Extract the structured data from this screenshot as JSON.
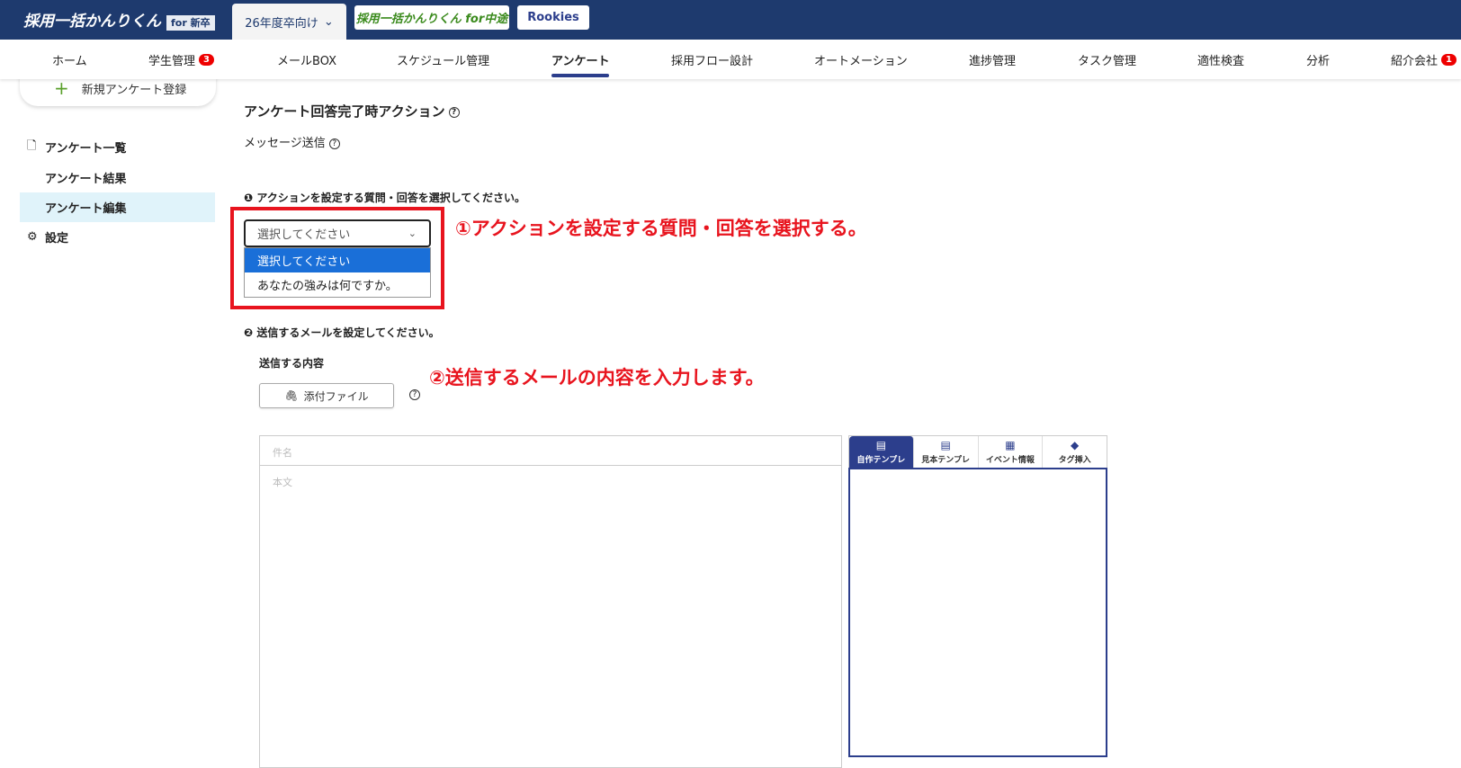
{
  "header": {
    "logo": "採用一括かんりくん",
    "logo_tag": "for 新卒",
    "year": "26年度卒向け",
    "chuto": "採用一括かんりくん for中途",
    "rookies": "Rookies"
  },
  "nav": [
    {
      "label": "ホーム"
    },
    {
      "label": "学生管理",
      "badge": "3"
    },
    {
      "label": "メールBOX"
    },
    {
      "label": "スケジュール管理"
    },
    {
      "label": "アンケート",
      "active": true
    },
    {
      "label": "採用フロー設計"
    },
    {
      "label": "オートメーション"
    },
    {
      "label": "進捗管理"
    },
    {
      "label": "タスク管理"
    },
    {
      "label": "適性検査"
    },
    {
      "label": "分析"
    },
    {
      "label": "紹介会社",
      "badge": "1"
    }
  ],
  "sidebar": {
    "register": "新規アンケート登録",
    "items": [
      {
        "label": "アンケート一覧"
      },
      {
        "label": "アンケート結果"
      },
      {
        "label": "アンケート編集"
      },
      {
        "label": "設定"
      }
    ]
  },
  "main": {
    "title": "アンケート回答完了時アクション",
    "subtitle": "メッセージ送信",
    "step1": "アクションを設定する質問・回答を選択してください。",
    "select_value": "選択してください",
    "options": [
      "選択してください",
      "あなたの強みは何ですか。"
    ],
    "step2": "送信するメールを設定してください。",
    "content_label": "送信する内容",
    "attach": "添付ファイル",
    "subject_placeholder": "件名",
    "body_placeholder": "本文",
    "tabs": [
      "自作テンプレ",
      "見本テンプレ",
      "イベント情報",
      "タグ挿入"
    ]
  },
  "annotations": {
    "note1": "①アクションを設定する質問・回答を選択する。",
    "note2": "②送信するメールの内容を入力します。"
  },
  "colors": {
    "header": "#1e3a6e",
    "accent": "#2c3e8c",
    "annotation": "#e8141e"
  }
}
